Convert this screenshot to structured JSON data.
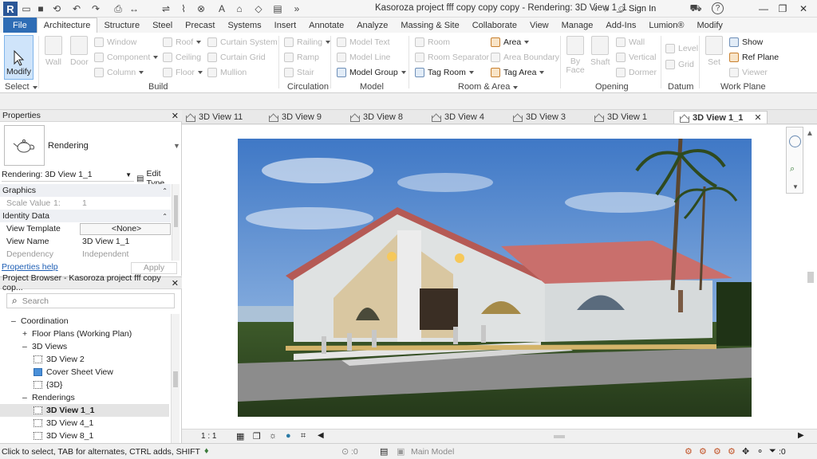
{
  "window": {
    "title": "Kasoroza project fff copy copy copy - Rendering: 3D View 1_1",
    "sign_in": "Sign In",
    "help": "?"
  },
  "ribbon_tabs": [
    "File",
    "Architecture",
    "Structure",
    "Steel",
    "Precast",
    "Systems",
    "Insert",
    "Annotate",
    "Analyze",
    "Massing & Site",
    "Collaborate",
    "View",
    "Manage",
    "Add-Ins",
    "Lumion®",
    "Modify"
  ],
  "active_tab": "Architecture",
  "ribbon": {
    "modify": "Modify",
    "select": "Select",
    "wall": "Wall",
    "door": "Door",
    "window": "Window",
    "component": "Component",
    "column": "Column",
    "roof": "Roof",
    "ceiling": "Ceiling",
    "floor": "Floor",
    "curtain_system": "Curtain System",
    "curtain_grid": "Curtain Grid",
    "mullion": "Mullion",
    "build": "Build",
    "railing": "Railing",
    "ramp": "Ramp",
    "stair": "Stair",
    "circulation": "Circulation",
    "model_text": "Model Text",
    "model_line": "Model Line",
    "model_group": "Model Group",
    "model": "Model",
    "room": "Room",
    "room_separator": "Room Separator",
    "tag_room": "Tag Room",
    "area": "Area",
    "area_boundary": "Area Boundary",
    "tag_area": "Tag Area",
    "room_area": "Room & Area",
    "by_face": "By Face",
    "shaft": "Shaft",
    "wall_opening": "Wall",
    "vertical": "Vertical",
    "dormer": "Dormer",
    "opening": "Opening",
    "level": "Level",
    "grid": "Grid",
    "datum": "Datum",
    "set": "Set",
    "show": "Show",
    "ref_plane": "Ref Plane",
    "viewer": "Viewer",
    "work_plane": "Work Plane"
  },
  "properties": {
    "header": "Properties",
    "type_name": "Rendering",
    "selector": "Rendering: 3D View 1_1",
    "edit_type": "Edit Type",
    "graphics_section": "Graphics",
    "scale_value_label": "Scale Value",
    "scale_value_prefix": "1:",
    "scale_value": "1",
    "identity_section": "Identity Data",
    "view_template_label": "View Template",
    "view_template_value": "<None>",
    "view_name_label": "View Name",
    "view_name_value": "3D View 1_1",
    "dependency_label": "Dependency",
    "dependency_value": "Independent",
    "help_link": "Properties help",
    "apply": "Apply"
  },
  "browser": {
    "header": "Project Browser - Kasoroza project fff copy cop...",
    "search_placeholder": "Search",
    "items": [
      {
        "label": "Coordination",
        "toggle": "–"
      },
      {
        "label": "Floor Plans (Working Plan)",
        "toggle": "+"
      },
      {
        "label": "3D Views",
        "toggle": "–"
      },
      {
        "label": "3D View 2"
      },
      {
        "label": "Cover Sheet View"
      },
      {
        "label": "{3D}"
      },
      {
        "label": "Renderings",
        "toggle": "–"
      },
      {
        "label": "3D View 1_1"
      },
      {
        "label": "3D View 4_1"
      },
      {
        "label": "3D View 8_1"
      }
    ]
  },
  "view_tabs": [
    "3D View 11",
    "3D View 9",
    "3D View 8",
    "3D View 4",
    "3D View 3",
    "3D View 1",
    "3D View 1_1"
  ],
  "active_view_tab": "3D View 1_1",
  "view_bar": {
    "scale": "1 : 1"
  },
  "status": {
    "hint": "Click to select, TAB for alternates, CTRL adds, SHIFT unselect",
    "coord": ":0",
    "model": "Main Model",
    "filter_count": ":0"
  },
  "colors": {
    "accent": "#2f6db5",
    "ribbon_bg": "#ffffff",
    "chrome": "#f0f0f0"
  }
}
